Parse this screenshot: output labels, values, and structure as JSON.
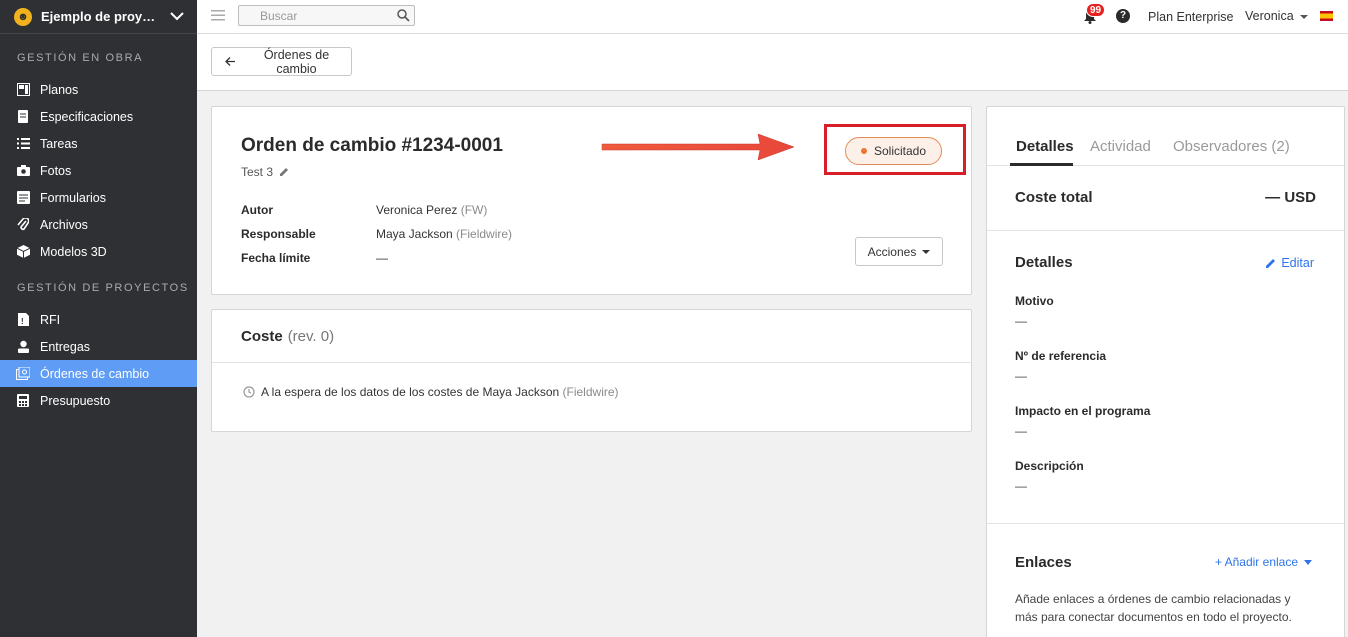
{
  "sidebar": {
    "project_name": "Ejemplo de proyecto...",
    "sections": [
      {
        "title": "GESTIÓN EN OBRA",
        "items": [
          {
            "label": "Planos",
            "icon": "plans-icon"
          },
          {
            "label": "Especificaciones",
            "icon": "specs-icon"
          },
          {
            "label": "Tareas",
            "icon": "tasks-icon"
          },
          {
            "label": "Fotos",
            "icon": "camera-icon"
          },
          {
            "label": "Formularios",
            "icon": "forms-icon"
          },
          {
            "label": "Archivos",
            "icon": "paperclip-icon"
          },
          {
            "label": "Modelos 3D",
            "icon": "cube-icon"
          }
        ]
      },
      {
        "title": "GESTIÓN DE PROYECTOS",
        "items": [
          {
            "label": "RFI",
            "icon": "rfi-icon"
          },
          {
            "label": "Entregas",
            "icon": "submittals-icon"
          },
          {
            "label": "Órdenes de cambio",
            "icon": "change-orders-icon",
            "active": true
          },
          {
            "label": "Presupuesto",
            "icon": "calculator-icon"
          }
        ]
      }
    ]
  },
  "topbar": {
    "search_placeholder": "Buscar",
    "notifications_count": "99",
    "help": "?",
    "plan": "Plan Enterprise",
    "user": "Veronica"
  },
  "subheader": {
    "back_label": "Órdenes de cambio"
  },
  "order": {
    "title": "Orden de cambio #1234-0001",
    "subtitle": "Test 3",
    "status": "Solicitado",
    "fields": {
      "author_label": "Autor",
      "author_value": "Veronica Perez",
      "author_org": "(FW)",
      "responsible_label": "Responsable",
      "responsible_value": "Maya Jackson",
      "responsible_org": "(Fieldwire)",
      "due_label": "Fecha límite",
      "due_value": "—"
    },
    "actions_label": "Acciones"
  },
  "cost": {
    "title": "Coste",
    "rev": "(rev. 0)",
    "waiting_text": "A la espera de los datos de los costes de Maya Jackson",
    "waiting_org": "(Fieldwire)"
  },
  "details_panel": {
    "tabs": [
      "Detalles",
      "Actividad",
      "Observadores"
    ],
    "observers_count": "(2)",
    "total_cost_label": "Coste total",
    "total_cost_value": "— USD",
    "details_title": "Detalles",
    "edit_label": "Editar",
    "fields": [
      {
        "label": "Motivo",
        "value": "—"
      },
      {
        "label": "Nº de referencia",
        "value": "—"
      },
      {
        "label": "Impacto en el programa",
        "value": "—"
      },
      {
        "label": "Descripción",
        "value": "—"
      }
    ],
    "links_title": "Enlaces",
    "add_link_label": "+ Añadir enlace",
    "links_description": "Añade enlaces a órdenes de cambio relacionadas y más para conectar documentos en todo el proyecto."
  },
  "colors": {
    "sidebar_bg": "#2f3033",
    "active_nav": "#5e9cf5",
    "status_dot": "#e87532",
    "highlight": "#d5202c",
    "link": "#2f74e8",
    "annotation_arrow": "#e8473a"
  }
}
